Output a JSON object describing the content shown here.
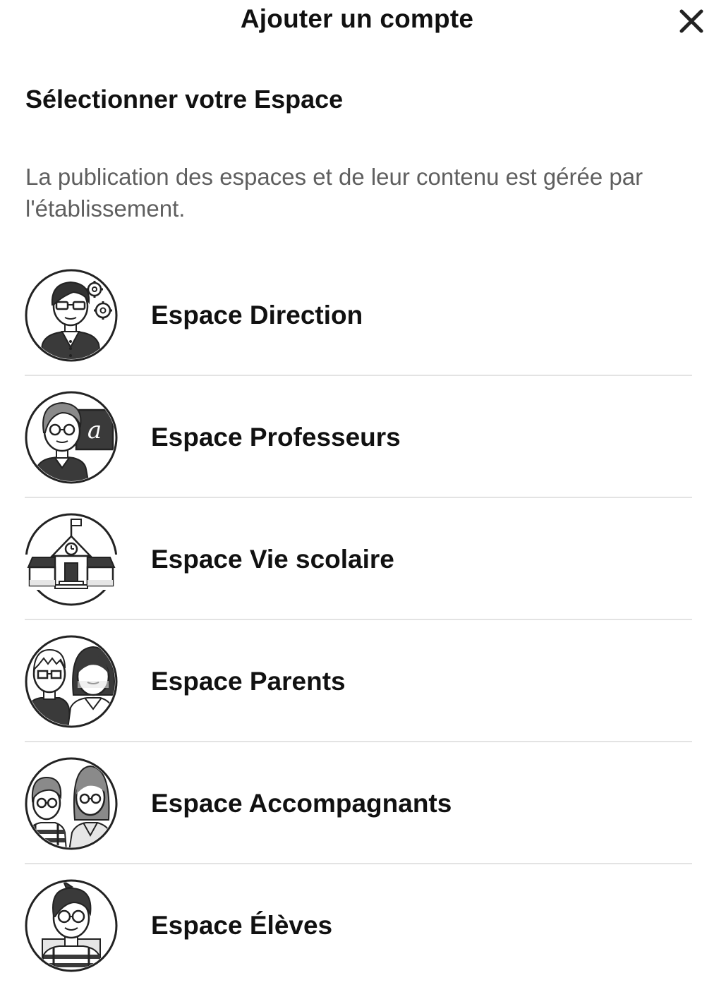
{
  "header": {
    "title": "Ajouter un compte",
    "close_icon": "close-icon"
  },
  "section": {
    "title": "Sélectionner votre Espace",
    "description": "La publication des espaces et de leur contenu est gérée par l'établissement."
  },
  "spaces": [
    {
      "label": "Espace Direction",
      "icon": "director-avatar-icon"
    },
    {
      "label": "Espace Professeurs",
      "icon": "teacher-avatar-icon"
    },
    {
      "label": "Espace Vie scolaire",
      "icon": "school-building-icon"
    },
    {
      "label": "Espace Parents",
      "icon": "parents-avatar-icon"
    },
    {
      "label": "Espace Accompagnants",
      "icon": "companions-avatar-icon"
    },
    {
      "label": "Espace Élèves",
      "icon": "student-avatar-icon"
    }
  ],
  "colors": {
    "text": "#111111",
    "muted": "#5f5f5f",
    "divider": "#e3e3e3",
    "icon_dark": "#333333",
    "icon_mid": "#8a8a8a",
    "icon_light": "#e6e6e6"
  }
}
